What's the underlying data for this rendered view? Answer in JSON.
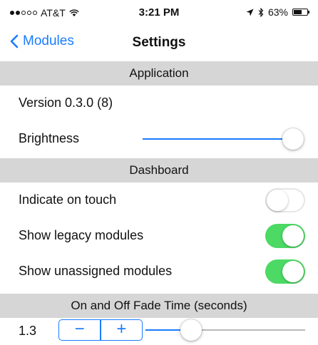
{
  "status_bar": {
    "carrier": "AT&T",
    "time": "3:21 PM",
    "battery": "63%",
    "battery_level": 0.63,
    "signal_bars": 2,
    "icons": [
      "signal-dots-icon",
      "wifi-icon",
      "location-arrow-icon",
      "bluetooth-icon",
      "battery-icon"
    ]
  },
  "nav": {
    "back_label": "Modules",
    "title": "Settings"
  },
  "sections": {
    "application": {
      "header": "Application",
      "version": "Version 0.3.0 (8)",
      "brightness_label": "Brightness",
      "brightness_value": 1.0
    },
    "dashboard": {
      "header": "Dashboard",
      "toggles": [
        {
          "label": "Indicate on touch",
          "on": false
        },
        {
          "label": "Show legacy modules",
          "on": true
        },
        {
          "label": "Show unassigned modules",
          "on": true
        }
      ]
    },
    "fade": {
      "header": "On and Off Fade Time (seconds)",
      "value": "1.3",
      "stepper_minus": "−",
      "stepper_plus": "+",
      "slider_value": 0.25
    }
  },
  "colors": {
    "accent": "#1a7cff",
    "toggle_on": "#4cd964",
    "section_bg": "#d6d6d6"
  }
}
